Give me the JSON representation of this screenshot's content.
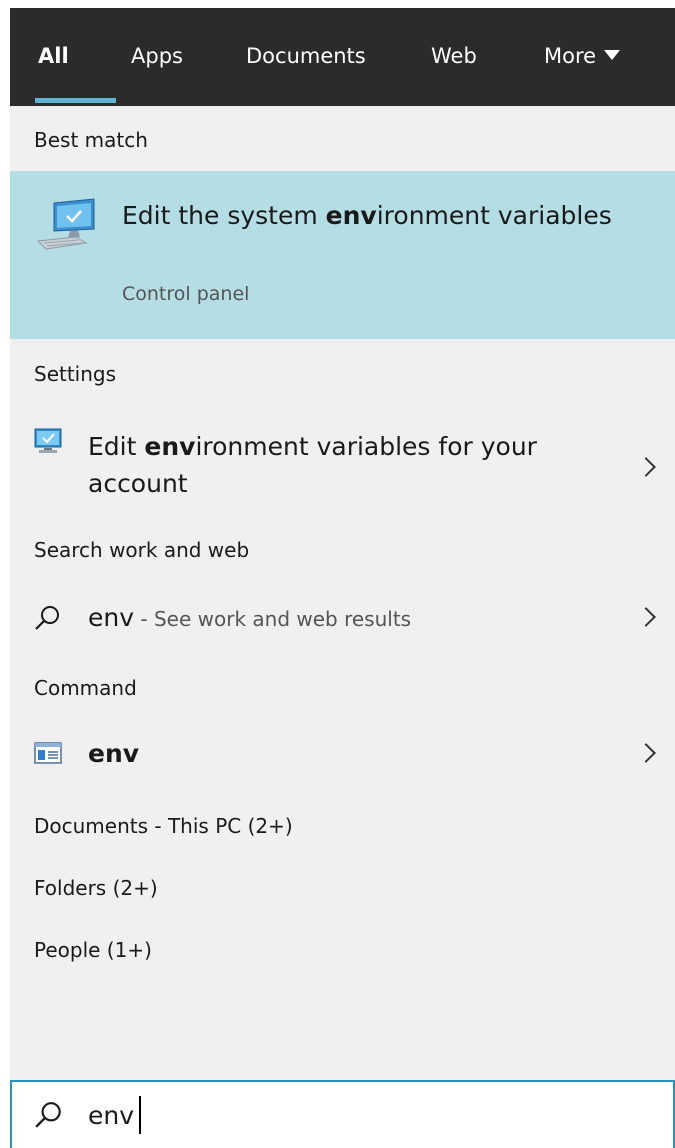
{
  "tabs": [
    {
      "label": "All",
      "active": true
    },
    {
      "label": "Apps"
    },
    {
      "label": "Documents"
    },
    {
      "label": "Web"
    },
    {
      "label": "More"
    }
  ],
  "best_match": {
    "header": "Best match",
    "title_pre": "Edit the system ",
    "title_bold": "env",
    "title_post": "ironment variables",
    "subtitle": "Control panel",
    "icon": "system-computer-icon"
  },
  "settings": {
    "header": "Settings",
    "item_pre": "Edit ",
    "item_bold": "env",
    "item_post": "ironment variables for your account",
    "icon": "monitor-settings-icon"
  },
  "search_web": {
    "header": "Search work and web",
    "query": "env",
    "suffix": " - See work and web results",
    "icon": "search-icon"
  },
  "command": {
    "header": "Command",
    "item": "env",
    "icon": "command-window-icon"
  },
  "collapsed_sections": [
    {
      "label": "Documents - This PC (2+)"
    },
    {
      "label": "Folders (2+)"
    },
    {
      "label": "People (1+)"
    }
  ],
  "searchbox": {
    "value": "env",
    "icon": "search-icon"
  },
  "colors": {
    "tabbar_bg": "#2b2b2b",
    "accent": "#5fb3d4",
    "selected_bg": "#b4dde4",
    "panel_bg": "#f0f0f0",
    "search_border": "#2b93bb"
  }
}
